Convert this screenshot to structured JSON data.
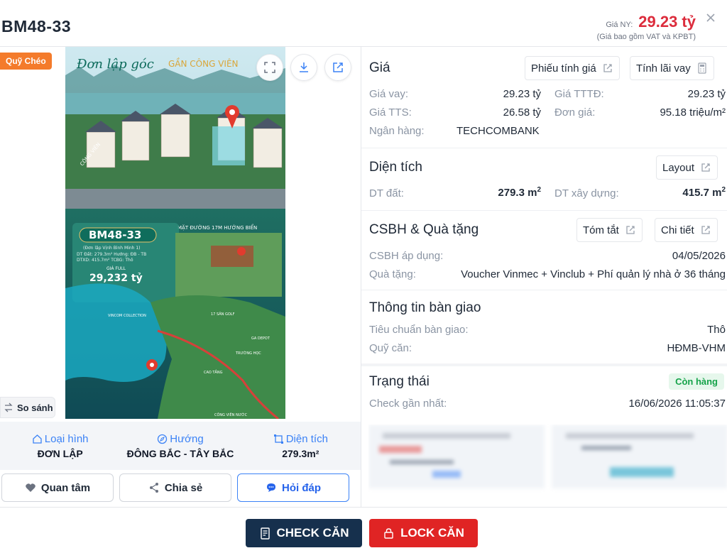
{
  "header": {
    "code": "BM48-33",
    "price_label": "Giá NY:",
    "price_value": "29.23 tỷ",
    "price_note": "(Giá bao gồm VAT và KPBT)"
  },
  "left": {
    "badge": "Quỹ Chéo",
    "compare_label": "So sánh",
    "poster": {
      "headline_1": "Đơn lập góc",
      "headline_2": "GẦN CÔNG VIÊN",
      "label_cong_vien": "CÔNG VIÊN",
      "road_label": "MẶT ĐƯỜNG 17M HƯỚNG BIỂN",
      "card_code": "BM48-33",
      "card_sub": "(Đơn lập Vịnh Bình Minh 1)",
      "card_l1": "DT Đất: 279.3m²  Hướng: ĐB - TB",
      "card_l2": "DTXD: 415.7m²  TCBG: Thô",
      "card_price_lbl": "GIÁ FULL",
      "card_price": "29,232 tỷ",
      "map_l1": "VINCOM COLLECTION",
      "map_l2": "17 SÂN GOLF",
      "map_l3": "GA DEPOT",
      "map_l4": "CÔNG VIÊN NƯỚC",
      "map_l5": "CAO TẦNG",
      "map_l6": "TRƯỜNG HỌC"
    },
    "attributes": [
      {
        "label": "Loại hình",
        "value": "ĐƠN LẬP"
      },
      {
        "label": "Hướng",
        "value": "ĐÔNG BẮC - TÂY BẮC"
      },
      {
        "label": "Diện tích",
        "value": "279.3m²"
      }
    ],
    "actions": {
      "favorite": "Quan tâm",
      "share": "Chia sẻ",
      "ask": "Hỏi đáp"
    }
  },
  "right": {
    "gia": {
      "title": "Giá",
      "btn_phieu": "Phiếu tính giá",
      "btn_lai": "Tính lãi vay",
      "rows": [
        {
          "label": "Giá vay:",
          "value": "29.23 tỷ"
        },
        {
          "label": "Giá TTTĐ:",
          "value": "29.23 tỷ"
        },
        {
          "label": "Giá TTS:",
          "value": "26.58 tỷ"
        },
        {
          "label": "Đơn giá:",
          "value": "95.18 triệu/m²"
        },
        {
          "label": "Ngân hàng:",
          "value": "TECHCOMBANK"
        }
      ]
    },
    "dien_tich": {
      "title": "Diện tích",
      "btn_layout": "Layout",
      "dt_dat_label": "DT đất:",
      "dt_dat_value": "279.3 m",
      "dt_xd_label": "DT xây dựng:",
      "dt_xd_value": "415.7 m",
      "unit_sup": "2"
    },
    "csbh": {
      "title": "CSBH & Quà tặng",
      "btn_tomtat": "Tóm tắt",
      "btn_chitiet": "Chi tiết",
      "ap_dung_label": "CSBH áp dụng:",
      "ap_dung_value": "04/05/2026",
      "qua_tang_label": "Quà tặng:",
      "qua_tang_value": "Voucher Vinmec + Vinclub + Phí quản lý nhà ở 36 tháng"
    },
    "ban_giao": {
      "title": "Thông tin bàn giao",
      "tieu_chuan_label": "Tiêu chuẩn bàn giao:",
      "tieu_chuan_value": "Thô",
      "quy_can_label": "Quỹ căn:",
      "quy_can_value": "HĐMB-VHM"
    },
    "trang_thai": {
      "title": "Trạng thái",
      "badge": "Còn hàng",
      "check_label": "Check gần nhất:",
      "check_value": "16/06/2026 11:05:37"
    }
  },
  "footer": {
    "check": "CHECK CĂN",
    "lock": "LOCK CĂN"
  },
  "colors": {
    "accent_blue": "#3b82f6",
    "price_red": "#dc2c3c",
    "badge_orange": "#f47b2b",
    "check_btn": "#16304d",
    "lock_btn": "#e02424",
    "status_green": "#16a34a"
  }
}
